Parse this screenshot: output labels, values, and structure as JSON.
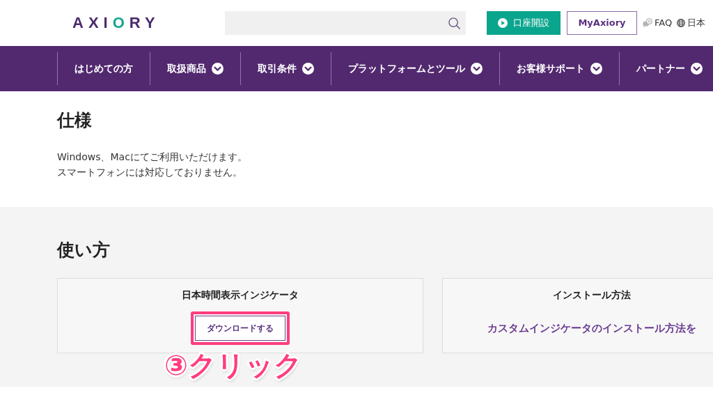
{
  "header": {
    "logo": "AXIORY",
    "buttons": [
      {
        "label": "口座開設",
        "kind": "primary"
      },
      {
        "label": "MyAxiory",
        "kind": "outline"
      }
    ],
    "links": [
      {
        "label": "FAQ",
        "kind": "faq"
      },
      {
        "label": "日本",
        "kind": "language"
      }
    ]
  },
  "nav": {
    "items": [
      {
        "label": "はじめての方",
        "dropdown": false
      },
      {
        "label": "取扱商品",
        "dropdown": true
      },
      {
        "label": "取引条件",
        "dropdown": true
      },
      {
        "label": "プラットフォームとツール",
        "dropdown": true
      },
      {
        "label": "お客様サポート",
        "dropdown": true
      },
      {
        "label": "パートナー",
        "dropdown": true
      }
    ]
  },
  "spec_section": {
    "title": "仕様",
    "lines": [
      "Windows、Macにてご利用いただけます。",
      "スマートフォンには対応しておりません。"
    ]
  },
  "usage_section": {
    "title": "使い方",
    "cards": [
      {
        "title": "日本時間表示インジケータ",
        "action": {
          "kind": "button",
          "label": "ダウンロードする",
          "highlighted": true
        }
      },
      {
        "title": "インストール方法",
        "action": {
          "kind": "link",
          "label": "カスタムインジケータのインストール方法を",
          "highlighted": false
        }
      }
    ]
  },
  "annotation": {
    "label": "③クリック"
  }
}
